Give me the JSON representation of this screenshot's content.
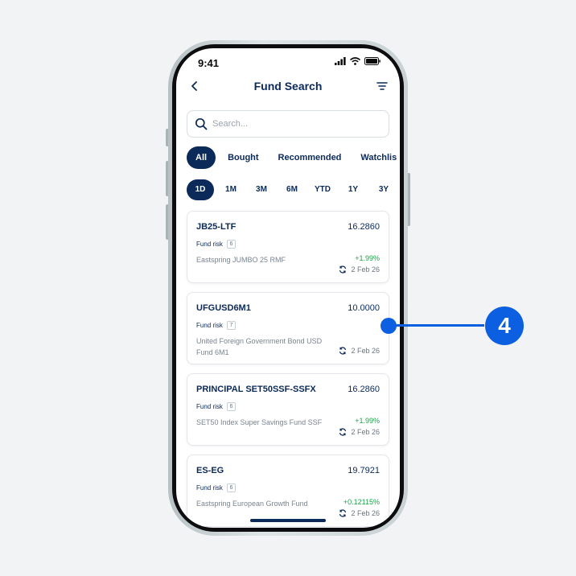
{
  "status_bar": {
    "time": "9:41"
  },
  "header": {
    "title": "Fund Search",
    "back_icon": "chevron-left-icon",
    "filter_icon": "filter-icon"
  },
  "search": {
    "placeholder": "Search...",
    "value": ""
  },
  "tabs": [
    {
      "label": "All",
      "active": true
    },
    {
      "label": "Bought",
      "active": false
    },
    {
      "label": "Recommended",
      "active": false
    },
    {
      "label": "Watchlis",
      "active": false
    }
  ],
  "periods": [
    {
      "label": "1D",
      "active": true
    },
    {
      "label": "1M",
      "active": false
    },
    {
      "label": "3M",
      "active": false
    },
    {
      "label": "6M",
      "active": false
    },
    {
      "label": "YTD",
      "active": false
    },
    {
      "label": "1Y",
      "active": false
    },
    {
      "label": "3Y",
      "active": false
    }
  ],
  "funds": [
    {
      "code": "JB25-LTF",
      "nav": "16.2860",
      "risk_label": "Fund risk",
      "risk_level": "6",
      "name": "Eastspring JUMBO 25 RMF",
      "change": "+1.99%",
      "date": "2 Feb 26"
    },
    {
      "code": "UFGUSD6M1",
      "nav": "10.0000",
      "risk_label": "Fund risk",
      "risk_level": "7",
      "name": "United Foreign Government Bond USD Fund 6M1",
      "change": "",
      "date": "2 Feb 26"
    },
    {
      "code": "PRINCIPAL SET50SSF-SSFX",
      "nav": "16.2860",
      "risk_label": "Fund risk",
      "risk_level": "6",
      "name": "SET50 Index Super Savings Fund SSF",
      "change": "+1.99%",
      "date": "2 Feb 26"
    },
    {
      "code": "ES-EG",
      "nav": "19.7921",
      "risk_label": "Fund risk",
      "risk_level": "6",
      "name": "Eastspring European Growth Fund",
      "change": "+0.12115%",
      "date": "2 Feb 26"
    }
  ],
  "callout": {
    "number": "4"
  },
  "colors": {
    "primary": "#0b2a59",
    "accent": "#0b5fe0",
    "positive": "#1aa34a"
  }
}
